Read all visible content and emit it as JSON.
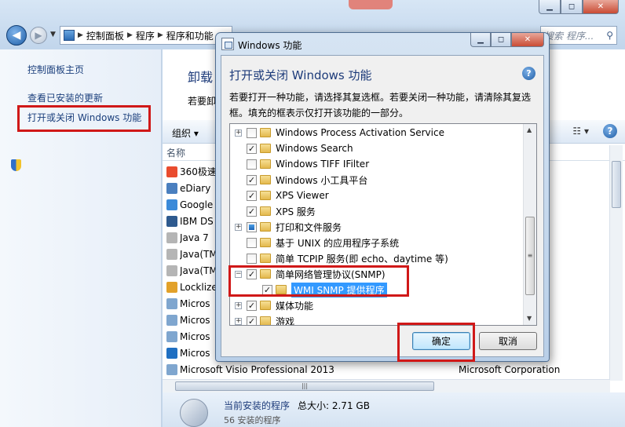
{
  "window": {
    "caption": {
      "min": "▁",
      "max": "◻",
      "close": "✕"
    },
    "address": {
      "crumbs": [
        "控制面板",
        "程序",
        "程序和功能"
      ],
      "search_placeholder": "搜索 程序..."
    },
    "left_pane": {
      "items": [
        {
          "label": "控制面板主页"
        },
        {
          "label": "查看已安装的更新"
        },
        {
          "label": "打开或关闭 Windows 功能"
        }
      ]
    },
    "main": {
      "heading": "卸载",
      "desc": "若要卸",
      "toolbar": {
        "organize": "组织 ▾",
        "view": "☷ ▾",
        "help": "?"
      },
      "column_name": "名称",
      "programs": [
        {
          "name": "360极速",
          "publisher": "",
          "icon_color": "#e94c2f"
        },
        {
          "name": "eDiary",
          "publisher": "",
          "icon_color": "#4a7fbf"
        },
        {
          "name": "Google",
          "publisher": "",
          "icon_color": "#3b8ad9"
        },
        {
          "name": "IBM DS",
          "publisher": "",
          "icon_color": "#2e5a8f"
        },
        {
          "name": "Java 7",
          "publisher": "",
          "icon_color": "#b5b5b5"
        },
        {
          "name": "Java(TM",
          "publisher": "",
          "icon_color": "#b5b5b5"
        },
        {
          "name": "Java(TM",
          "publisher": "",
          "icon_color": "#b5b5b5"
        },
        {
          "name": "Locklize",
          "publisher": "",
          "icon_color": "#e2a12a"
        },
        {
          "name": "Micros",
          "publisher": "",
          "icon_color": "#7fa6cf"
        },
        {
          "name": "Micros",
          "publisher": "",
          "icon_color": "#7fa6cf"
        },
        {
          "name": "Micros",
          "publisher": "",
          "icon_color": "#7fa6cf"
        },
        {
          "name": "Micros",
          "publisher": "",
          "icon_color": "#1f6fc2"
        },
        {
          "name": "Microsoft Visio Professional 2013",
          "publisher": "Microsoft Corporation",
          "icon_color": "#7fa6cf"
        }
      ],
      "details": {
        "title": "当前安装的程序",
        "size": "总大小: 2.71 GB",
        "count": "56 安装的程序"
      }
    }
  },
  "dialog": {
    "title": "Windows 功能",
    "heading": "打开或关闭 Windows 功能",
    "help": "?",
    "description": "若要打开一种功能，请选择其复选框。若要关闭一种功能，请清除其复选框。填充的框表示仅打开该功能的一部分。",
    "features": [
      {
        "label": "Windows Process Activation Service",
        "expandable": true,
        "state": "unchecked",
        "indent": 0
      },
      {
        "label": "Windows Search",
        "expandable": false,
        "state": "checked",
        "indent": 0
      },
      {
        "label": "Windows TIFF IFilter",
        "expandable": false,
        "state": "unchecked",
        "indent": 0
      },
      {
        "label": "Windows 小工具平台",
        "expandable": false,
        "state": "checked",
        "indent": 0
      },
      {
        "label": "XPS Viewer",
        "expandable": false,
        "state": "checked",
        "indent": 0
      },
      {
        "label": "XPS 服务",
        "expandable": false,
        "state": "checked",
        "indent": 0
      },
      {
        "label": "打印和文件服务",
        "expandable": true,
        "state": "partial",
        "indent": 0
      },
      {
        "label": "基于 UNIX 的应用程序子系统",
        "expandable": false,
        "state": "unchecked",
        "indent": 0
      },
      {
        "label": "简单 TCPIP 服务(即 echo、daytime 等)",
        "expandable": false,
        "state": "unchecked",
        "indent": 0
      },
      {
        "label": "简单网络管理协议(SNMP)",
        "expandable": true,
        "expanded": true,
        "state": "checked",
        "indent": 0
      },
      {
        "label": "WMI SNMP 提供程序",
        "expandable": false,
        "state": "checked",
        "indent": 1,
        "selected": true
      },
      {
        "label": "媒体功能",
        "expandable": true,
        "state": "checked",
        "indent": 0
      },
      {
        "label": "游戏",
        "expandable": true,
        "state": "checked",
        "indent": 0
      }
    ],
    "ok_label": "确定",
    "cancel_label": "取消"
  }
}
